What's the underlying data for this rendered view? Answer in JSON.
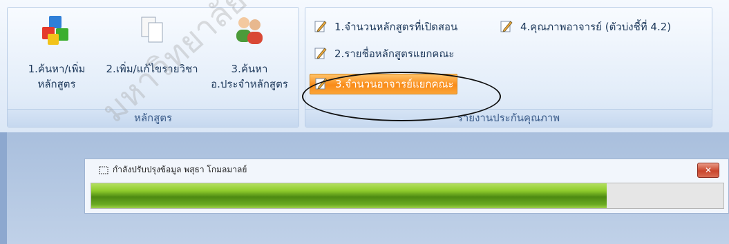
{
  "ribbon": {
    "group1": {
      "label": "หลักสูตร",
      "buttons": [
        {
          "line1": "1.ค้นหา/เพิ่ม",
          "line2": "หลักสูตร",
          "icon": "cubes-icon"
        },
        {
          "line1": "2.เพิ่ม/แก้ไขรายวิชา",
          "line2": "",
          "icon": "copy-pages-icon"
        },
        {
          "line1": "3.ค้นหา",
          "line2": "อ.ประจำหลักสูตร",
          "icon": "people-icon"
        }
      ]
    },
    "group2": {
      "label": "รายงานประกันคุณภาพ",
      "items": [
        {
          "label": "1.จำนวนหลักสูตรที่เปิดสอน",
          "icon": "edit-report-icon"
        },
        {
          "label": "4.คุณภาพอาจารย์ (ตัวบ่งชี้ที่ 4.2)",
          "icon": "edit-report-icon"
        },
        {
          "label": "2.รายชื่อหลักสูตรแยกคณะ",
          "icon": "edit-report-icon"
        },
        {
          "label": "3.จำนวนอาจารย์แยกคณะ",
          "icon": "edit-report-icon",
          "highlighted": true
        }
      ]
    }
  },
  "dialog": {
    "title": "กำลังปรับปรุงข้อมูล พสุธา  โกมลมาลย์",
    "close": "✕",
    "progress": 0.815
  },
  "watermark": "มหาวิทยาลัย",
  "colors": {
    "accent": "#f98b18",
    "progress": "#6aaa22"
  }
}
